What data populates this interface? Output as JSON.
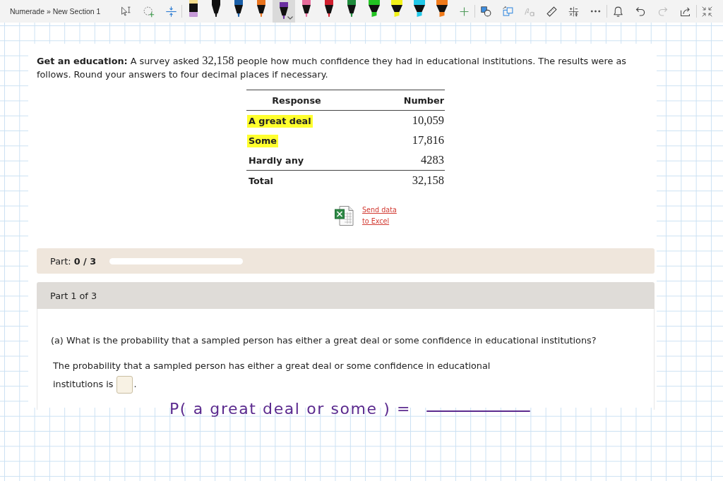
{
  "toolbar": {
    "breadcrumb": "Numerade » New Section 1",
    "select_tools": [
      {
        "kind": "lasso"
      },
      {
        "kind": "lasso-add"
      },
      {
        "kind": "insert-space"
      }
    ],
    "pens": [
      {
        "kind": "eraser",
        "selected": false
      },
      {
        "kind": "pen",
        "color": "#111111",
        "selected": false
      },
      {
        "kind": "pen",
        "color": "#1a5fa8",
        "selected": false
      },
      {
        "kind": "pen",
        "color": "#e8731e",
        "selected": false
      },
      {
        "kind": "pen",
        "color": "#6a2fa0",
        "selected": true
      },
      {
        "kind": "pen",
        "color": "#e56b9a",
        "selected": false
      },
      {
        "kind": "pen",
        "color": "#d0202f",
        "selected": false
      },
      {
        "kind": "pen",
        "color": "#1f8a3c",
        "selected": false
      },
      {
        "kind": "highlighter",
        "color": "#22c422",
        "selected": false
      },
      {
        "kind": "highlighter",
        "color": "#f2f21a",
        "selected": false
      },
      {
        "kind": "highlighter",
        "color": "#22c8e8",
        "selected": false
      },
      {
        "kind": "highlighter",
        "color": "#f07a1a",
        "selected": false
      }
    ],
    "ink_tools": [
      {
        "kind": "shapes",
        "disabled": false
      },
      {
        "kind": "ink-to-shape",
        "disabled": false
      },
      {
        "kind": "ink-to-text",
        "disabled": true
      },
      {
        "kind": "ruler",
        "disabled": false
      },
      {
        "kind": "math",
        "disabled": false
      },
      {
        "kind": "more",
        "disabled": false
      }
    ],
    "page_tools": [
      {
        "kind": "notifications",
        "disabled": false
      },
      {
        "kind": "undo",
        "disabled": false
      },
      {
        "kind": "redo",
        "disabled": true
      },
      {
        "kind": "share",
        "disabled": false
      }
    ],
    "window_tools": [
      {
        "kind": "collapse"
      }
    ]
  },
  "problem": {
    "lead": "Get an education:",
    "before": "A survey asked",
    "figure": "32,158",
    "after": "people how much confidence they had in educational institutions. The results were as follows. Round your answers to four decimal places if necessary."
  },
  "table": {
    "columns": [
      "Response",
      "Number"
    ],
    "rows": [
      {
        "response": "A great deal",
        "number": "10,059",
        "highlighted": true
      },
      {
        "response": "Some",
        "number": "17,816",
        "highlighted": true
      },
      {
        "response": "Hardly any",
        "number": "4283",
        "highlighted": false
      }
    ],
    "total": {
      "response": "Total",
      "number": "32,158"
    }
  },
  "export_link": "Send data to Excel",
  "progress": {
    "text": "Part: **0 / 3**",
    "level": 0
  },
  "part": {
    "title": "Part 1 of 3",
    "question": "(a) What is the probability that a sampled person has either a great deal or some confidence in educational institutions?",
    "answer_prompt": "The probability that a sampled person has either a great deal or some confidence in educational institutions is",
    "answer_suffix": "."
  },
  "ink": {
    "text": "P( a great deal or some ) ="
  }
}
